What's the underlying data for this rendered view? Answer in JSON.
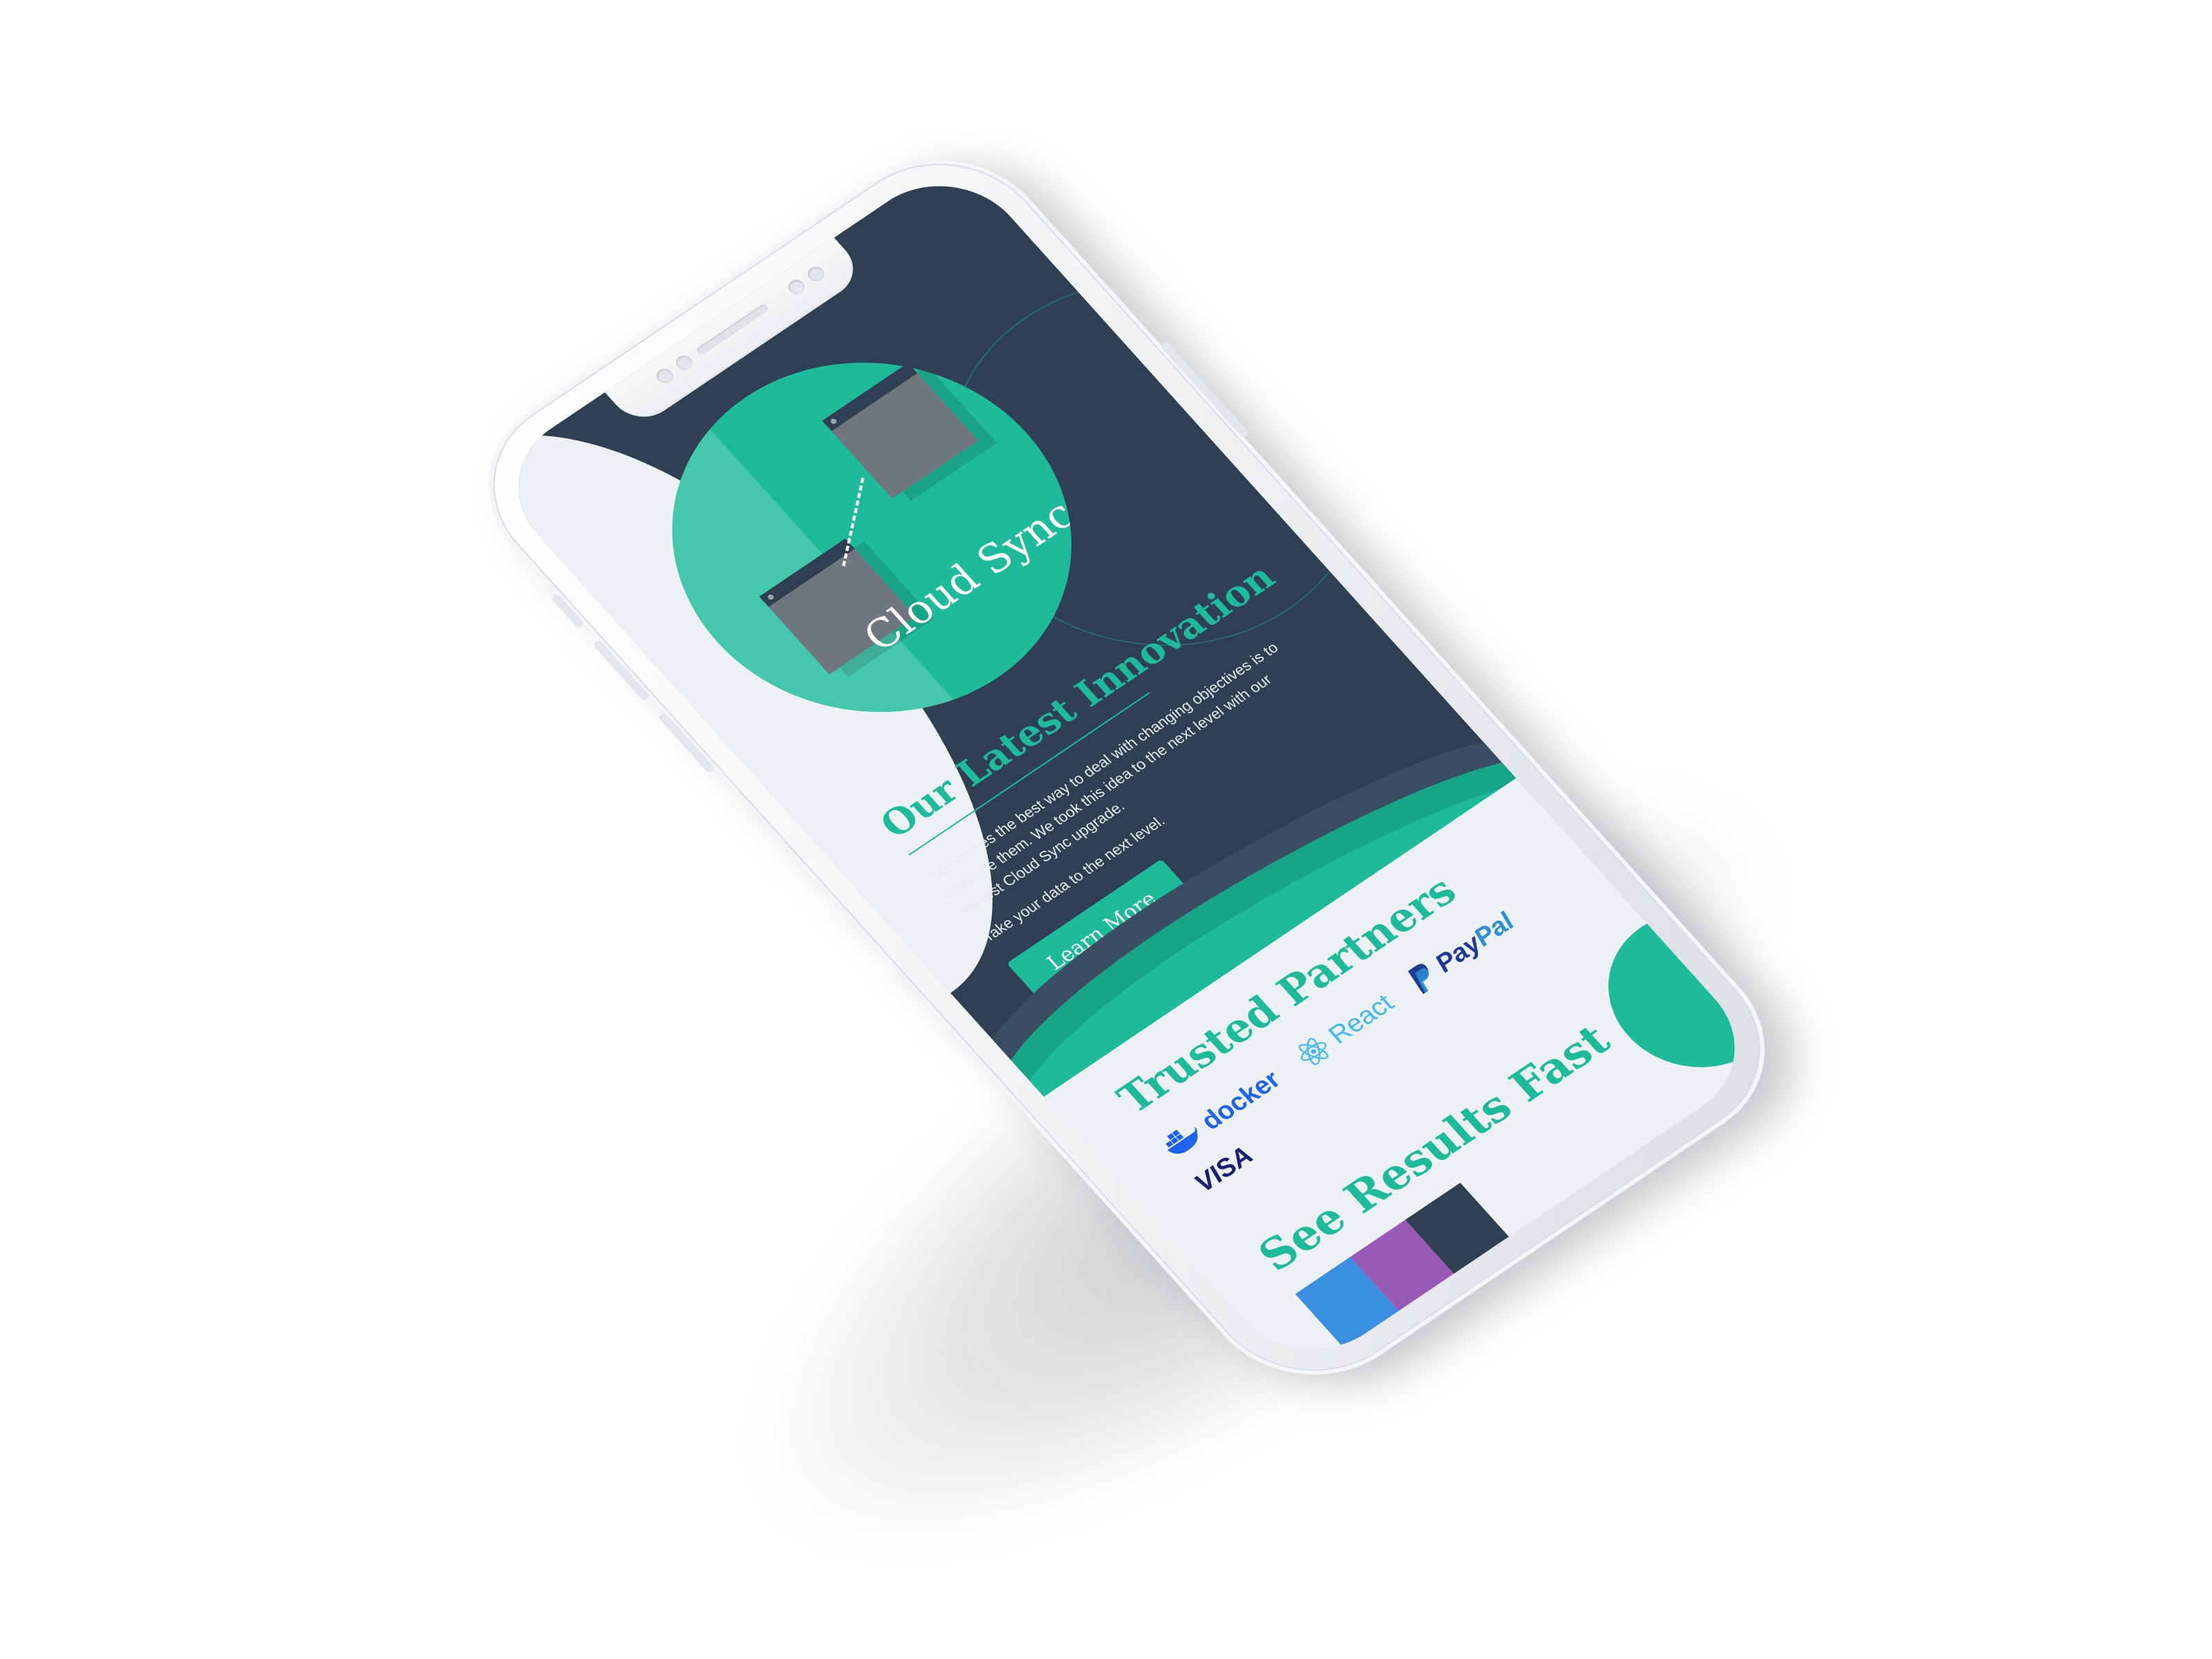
{
  "hero": {
    "badge_title": "Cloud Sync",
    "badge_icon": "sync-icon",
    "section_title": "Our Latest Innovation",
    "body": "Sometimes the best way to deal with changing objectives is to embrace them. We took this idea to the next level with our newest Cloud Sync upgrade.",
    "subtext": "Take your data to the next level.",
    "cta_label": "Learn More"
  },
  "partners": {
    "title": "Trusted Partners",
    "logos": [
      {
        "name": "docker",
        "label": "docker",
        "icon": "docker-whale-icon"
      },
      {
        "name": "react",
        "label": "React",
        "icon": "react-atom-icon"
      },
      {
        "name": "paypal",
        "label_a": "Pay",
        "label_b": "Pal",
        "icon": "paypal-icon"
      },
      {
        "name": "visa",
        "label": "VISA",
        "icon": "visa-icon"
      }
    ]
  },
  "results": {
    "title": "See Results Fast"
  },
  "colors": {
    "accent": "#1dbb9b",
    "dark": "#2f4053",
    "light": "#eef1f3",
    "bar_blue": "#3b8fe0",
    "bar_purple": "#9b59b6",
    "bar_dark": "#2f4053"
  }
}
